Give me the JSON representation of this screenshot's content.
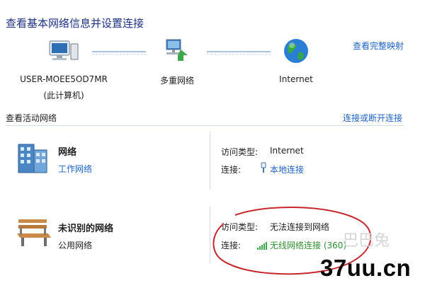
{
  "header": {
    "title": "查看基本网络信息并设置连接",
    "map_link": "查看完整映射"
  },
  "map": {
    "nodes": [
      {
        "label": "USER-MOEE5OD7MR",
        "sublabel": "(此计算机)",
        "icon": "computer-icon"
      },
      {
        "label": "多重网络",
        "icon": "multiple-networks-icon"
      },
      {
        "label": "Internet",
        "icon": "globe-icon"
      }
    ]
  },
  "active": {
    "title": "查看活动网络",
    "connect_link": "连接或断开连接"
  },
  "networks": [
    {
      "name": "网络",
      "type": "工作网络",
      "icon": "building-network-icon",
      "access_label": "访问类型:",
      "access_value": "Internet",
      "conn_label": "连接:",
      "conn_value": "本地连接",
      "conn_icon": "ethernet-plug-icon"
    },
    {
      "name": "未识别的网络",
      "type": "公用网络",
      "icon": "park-bench-icon",
      "access_label": "访问类型:",
      "access_value": "无法连接到网络",
      "conn_label": "连接:",
      "conn_value": "无线网络连接 (360)",
      "conn_icon": "wifi-signal-icon"
    }
  ],
  "colors": {
    "title": "#1e3287",
    "link": "#1e64c8",
    "wireless_link": "#2f8f2f",
    "annotation_circle": "#c8282d"
  },
  "watermark": {
    "text": "37uu.cn",
    "faint_text": "巴巴兔"
  }
}
